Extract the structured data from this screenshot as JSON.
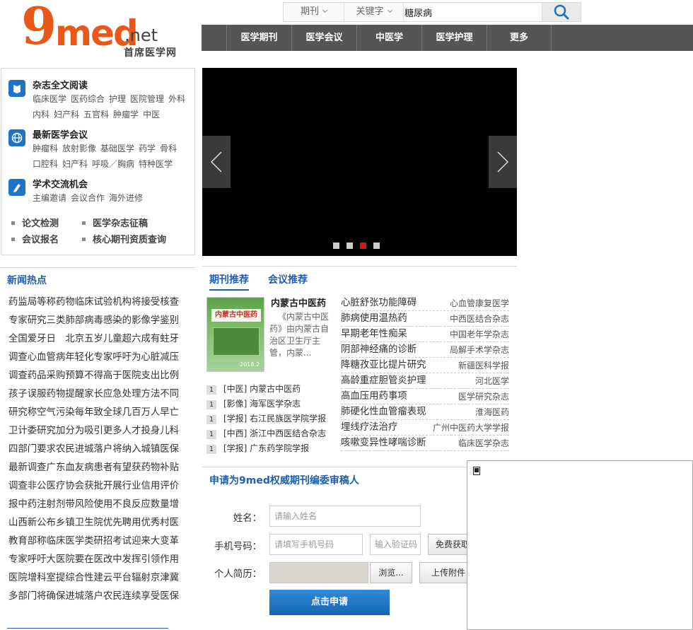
{
  "logo": {
    "digit": "9",
    "word": "med",
    "domain": ".net",
    "tagline": "首席医学网"
  },
  "search": {
    "category_label": "期刊",
    "field_label": "关键字",
    "query": "糖尿病"
  },
  "nav": {
    "items": [
      "医学期刊",
      "医学会议",
      "中医学",
      "医学护理",
      "更多"
    ]
  },
  "categories": [
    {
      "title": "杂志全文阅读",
      "icon": "book-icon",
      "links": [
        [
          "临床医学",
          "医药综合",
          "护理",
          "医院管理",
          "外科"
        ],
        [
          "内科",
          "妇产科",
          "五官科",
          "肿瘤学",
          "中医"
        ]
      ]
    },
    {
      "title": "最新医学会议",
      "icon": "globe-icon",
      "links": [
        [
          "肿瘤科",
          "放射影像",
          "基础医学",
          "药学",
          "骨科"
        ],
        [
          "口腔科",
          "妇产科",
          "呼吸／胸病",
          "特种医学"
        ]
      ]
    },
    {
      "title": "学术交流机会",
      "icon": "pen-icon",
      "links": [
        [
          "主编邀请",
          "会议合作",
          "海外进修"
        ]
      ]
    }
  ],
  "quick_links": [
    "论文检测",
    "医学杂志征稿",
    "会议报名",
    "核心期刊资质查询"
  ],
  "slider": {
    "dot_count": 4,
    "active_dot": 3
  },
  "news": {
    "title": "新闻热点",
    "items": [
      "药监局等称药物临床试验机构将接受核查",
      "专家研究三类肺部病毒感染的影像学鉴别",
      "全国爱牙日　北京五岁儿童超六成有蛀牙",
      "调查心血管病年轻化专家呼吁为心脏减压",
      "调查药品采购预算不得高于医院支出比例",
      "孩子误服药物提醒家长应急处理方法不同",
      "研究称空气污染每年致全球几百万人早亡",
      "卫计委研究加分为吸引更多人才投身儿科",
      "四部门要求农民进城落户将纳入城镇医保",
      "最新调查广东血友病患者有望获药物补贴",
      "调查非公医疗协会获批开展行业信用评价",
      "报中药注射剂带风险使用不良反应数量增",
      "山西新公布乡镇卫生院优先聘用优秀村医",
      "教育部称临床医学类研招考试迎来大变革",
      "专家呼吁大医院要在医改中发挥引领作用",
      "医院增科室提综合性建云平台辐射京津冀",
      "多部门将确保进城落户农民连续享受医保"
    ]
  },
  "journals": {
    "tabs": [
      "期刊推荐",
      "会议推荐"
    ],
    "featured": {
      "name": "内蒙古中医药",
      "desc": "《内蒙古中医药》由内蒙古自治区卫生厅主管，内蒙...",
      "cover_title": "内蒙古中医药",
      "cover_number": "2018.2"
    },
    "ranking": [
      {
        "n": "1",
        "text": "[中医] 内蒙古中医药"
      },
      {
        "n": "1",
        "text": "[影像] 海军医学杂志"
      },
      {
        "n": "1",
        "text": "[学报] 右江民族医学院学报"
      },
      {
        "n": "1",
        "text": "[中西] 浙江中西医结合杂志"
      },
      {
        "n": "1",
        "text": "[学报] 广东药学院学报"
      }
    ],
    "articles": [
      {
        "title": "心脏舒张功能障碍",
        "source": "心血管康复医学"
      },
      {
        "title": "肺病使用温热药",
        "source": "中西医结合杂志"
      },
      {
        "title": "早期老年性痴呆",
        "source": "中国老年学杂志"
      },
      {
        "title": "阴部神经痛的诊断",
        "source": "局解手术学杂志"
      },
      {
        "title": "降糖孜亚比提片研究",
        "source": "新疆医科学报"
      },
      {
        "title": "高龄重症胆管炎护理",
        "source": "河北医学"
      },
      {
        "title": "高血压用药事项",
        "source": "医学研究杂志"
      },
      {
        "title": "肺硬化性血管瘤表现",
        "source": "淮海医药"
      },
      {
        "title": "埋线疗法治疗",
        "source": "广州中医药大学学报"
      },
      {
        "title": "咳嗽变异性哮喘诊断",
        "source": "临床医学杂志"
      }
    ]
  },
  "apply": {
    "title": "申请为9med权威期刊编委审稿人",
    "name_label": "姓名：",
    "name_placeholder": "请输入姓名",
    "phone_label": "手机号码：",
    "phone_placeholder": "请填写手机号码",
    "code_placeholder": "输入验证码",
    "get_code": "免费获取",
    "resume_label": "个人简历：",
    "browse": "浏览...",
    "upload": "上传附件",
    "submit": "点击申请"
  }
}
